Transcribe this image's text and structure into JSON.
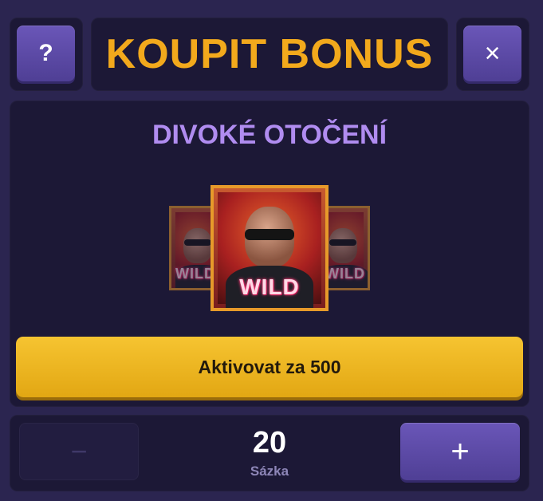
{
  "header": {
    "help_label": "?",
    "title": "KOUPIT BONUS",
    "close_label": "×"
  },
  "bonus": {
    "name": "DIVOKÉ OTOČENÍ",
    "symbol_text": "WILD",
    "activate_label": "Aktivovat za 500"
  },
  "bet": {
    "decrease_label": "−",
    "value": "20",
    "label": "Sázka",
    "increase_label": "+"
  },
  "colors": {
    "background": "#2b2550",
    "panel": "#1c1836",
    "accent_gold": "#f2a91c",
    "accent_purple": "#b08cf0",
    "button_purple": "#5b4aa6"
  }
}
